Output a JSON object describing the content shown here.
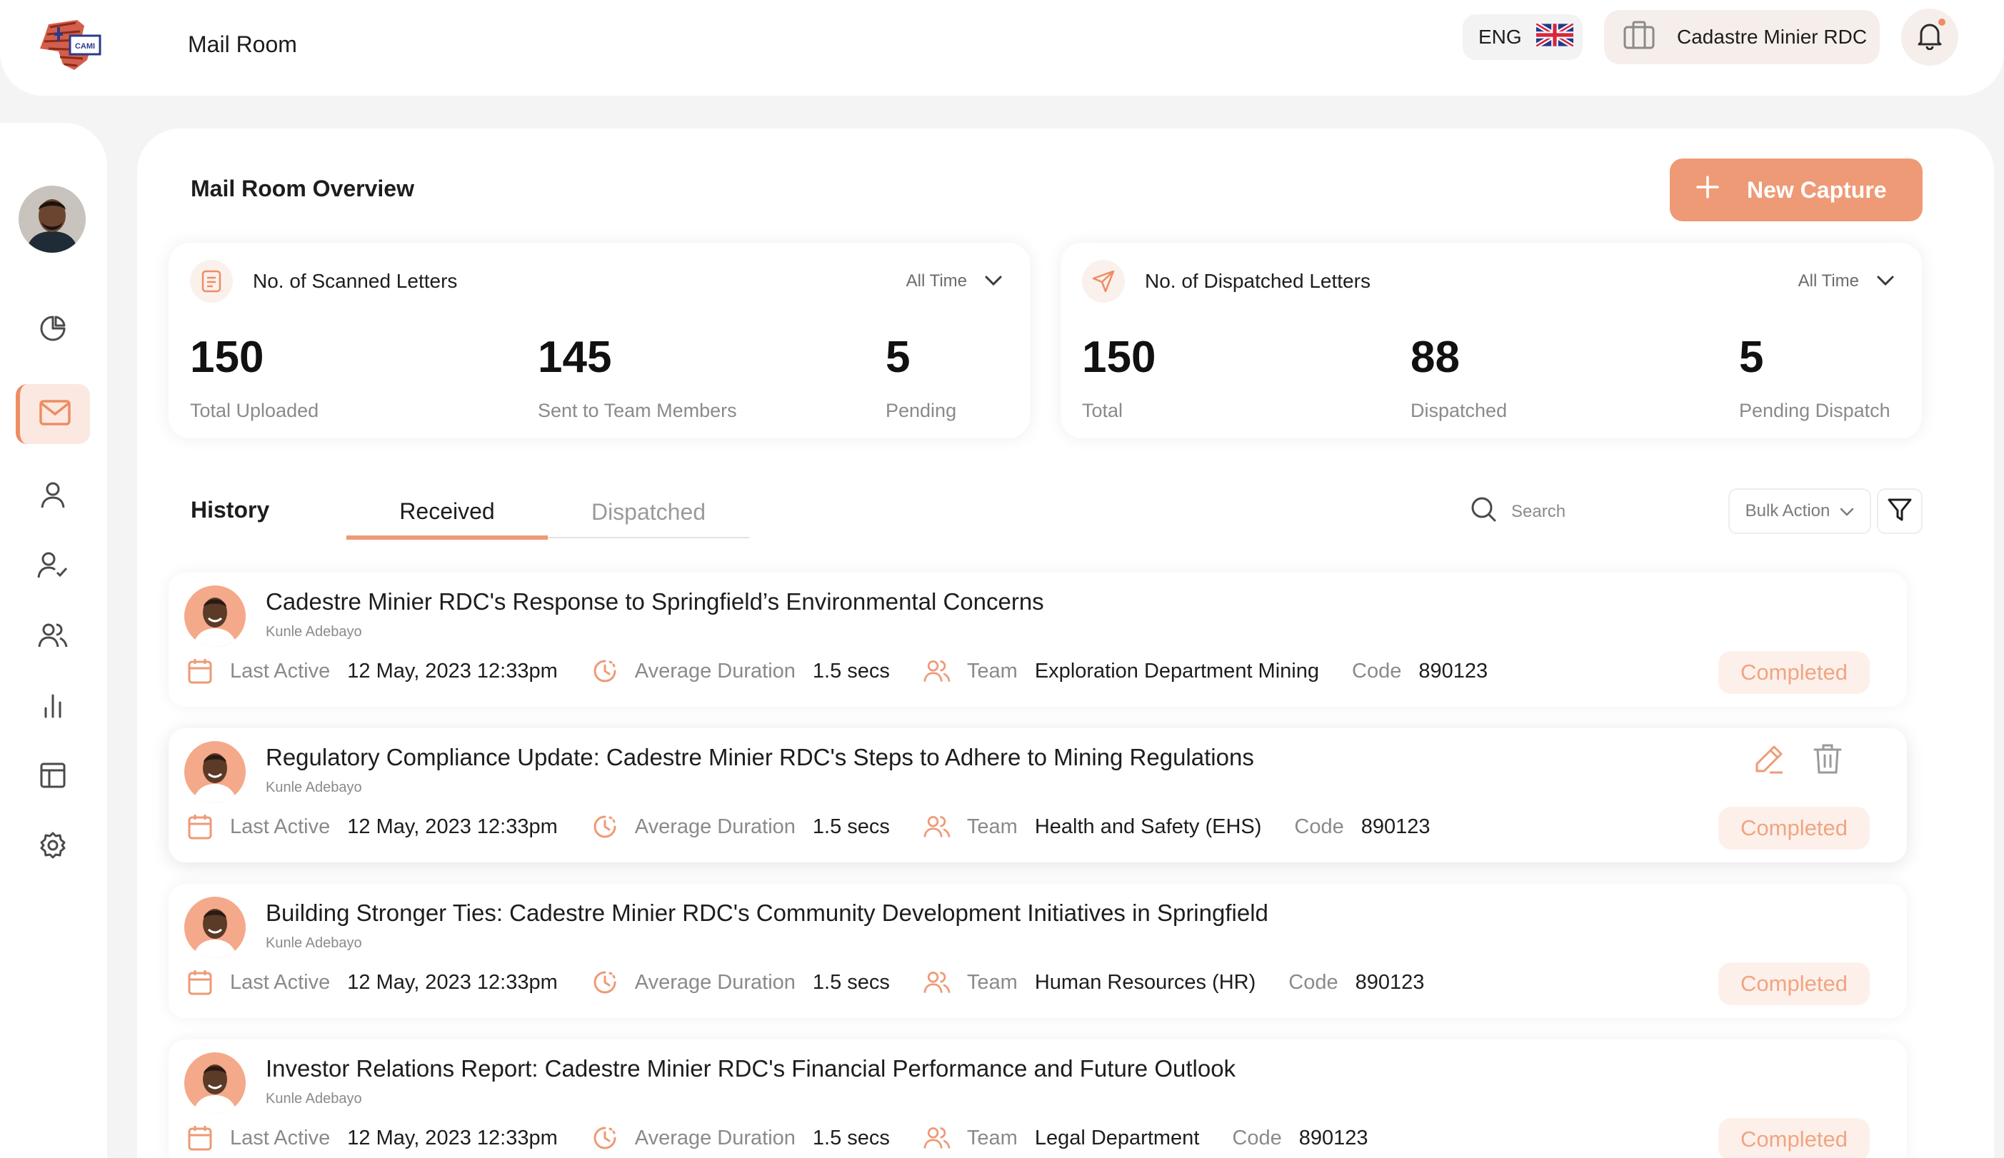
{
  "header": {
    "app_title": "Mail Room",
    "logo_text": "CAMI",
    "language": "ENG",
    "organization": "Cadastre Minier RDC"
  },
  "colors": {
    "accent": "#ee9a76",
    "accent_light": "#fdf0ea",
    "status_completed": "#f0a582"
  },
  "sidebar": {
    "items": [
      {
        "name": "dashboard",
        "icon": "pie-chart-icon"
      },
      {
        "name": "mail-room",
        "icon": "mail-icon",
        "active": true
      },
      {
        "name": "users",
        "icon": "user-icon"
      },
      {
        "name": "user-approval",
        "icon": "user-check-icon"
      },
      {
        "name": "teams",
        "icon": "users-icon"
      },
      {
        "name": "reports",
        "icon": "bar-chart-icon"
      },
      {
        "name": "layout",
        "icon": "layout-icon"
      },
      {
        "name": "settings",
        "icon": "gear-icon"
      }
    ]
  },
  "overview": {
    "title": "Mail Room Overview",
    "new_capture_label": "New Capture",
    "scanned": {
      "title": "No. of Scanned Letters",
      "range": "All Time",
      "stats": [
        {
          "value": "150",
          "label": "Total Uploaded"
        },
        {
          "value": "145",
          "label": "Sent to Team Members"
        },
        {
          "value": "5",
          "label": "Pending"
        }
      ]
    },
    "dispatched": {
      "title": "No. of Dispatched Letters",
      "range": "All Time",
      "stats": [
        {
          "value": "150",
          "label": "Total"
        },
        {
          "value": "88",
          "label": "Dispatched"
        },
        {
          "value": "5",
          "label": "Pending Dispatch"
        }
      ]
    }
  },
  "history": {
    "title": "History",
    "tabs": [
      "Received",
      "Dispatched"
    ],
    "active_tab": "Received",
    "search_placeholder": "Search",
    "bulk_action_label": "Bulk Action",
    "labels": {
      "last_active": "Last Active",
      "avg_duration": "Average Duration",
      "team": "Team",
      "code": "Code"
    },
    "rows": [
      {
        "title": "Cadestre Minier RDC's Response to Springfield’s Environmental Concerns",
        "author": "Kunle Adebayo",
        "last_active": "12 May, 2023 12:33pm",
        "avg_duration": "1.5 secs",
        "team": "Exploration Department Mining",
        "code": "890123",
        "status": "Completed"
      },
      {
        "title": "Regulatory Compliance Update: Cadestre Minier RDC's Steps to Adhere to Mining Regulations",
        "author": "Kunle Adebayo",
        "last_active": "12 May, 2023 12:33pm",
        "avg_duration": "1.5 secs",
        "team": "Health and Safety (EHS)",
        "code": "890123",
        "status": "Completed"
      },
      {
        "title": "Building Stronger Ties: Cadestre Minier RDC's Community Development Initiatives in Springfield",
        "author": "Kunle Adebayo",
        "last_active": "12 May, 2023 12:33pm",
        "avg_duration": "1.5 secs",
        "team": "Human Resources (HR)",
        "code": "890123",
        "status": "Completed"
      },
      {
        "title": "Investor Relations Report: Cadestre Minier RDC's Financial Performance and Future Outlook",
        "author": "Kunle Adebayo",
        "last_active": "12 May, 2023 12:33pm",
        "avg_duration": "1.5 secs",
        "team": "Legal Department",
        "code": "890123",
        "status": "Completed"
      }
    ]
  }
}
